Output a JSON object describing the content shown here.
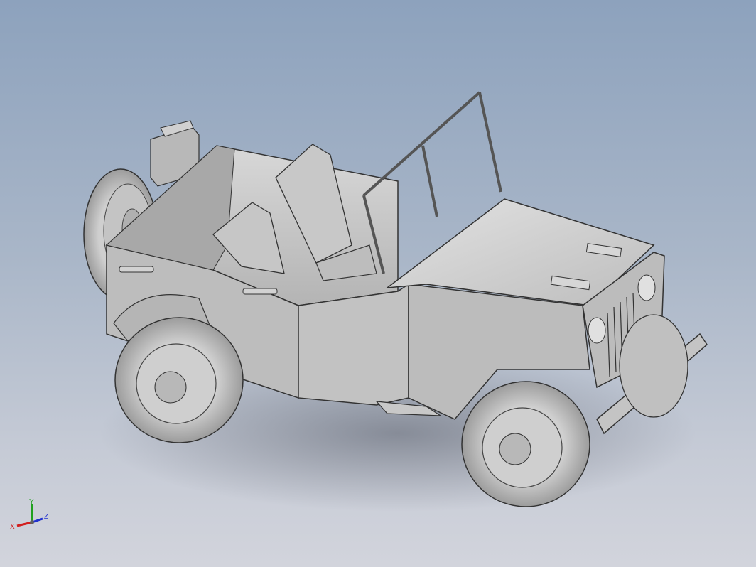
{
  "viewport": {
    "background_top": "#8da2bd",
    "background_bottom": "#d2d4dc",
    "model_color": "#c9c9c9"
  },
  "model": {
    "subject": "jeep-model"
  },
  "triad": {
    "x_label": "X",
    "y_label": "Y",
    "z_label": "Z",
    "x_color": "#d22020",
    "y_color": "#20a020",
    "z_color": "#2030d0"
  }
}
